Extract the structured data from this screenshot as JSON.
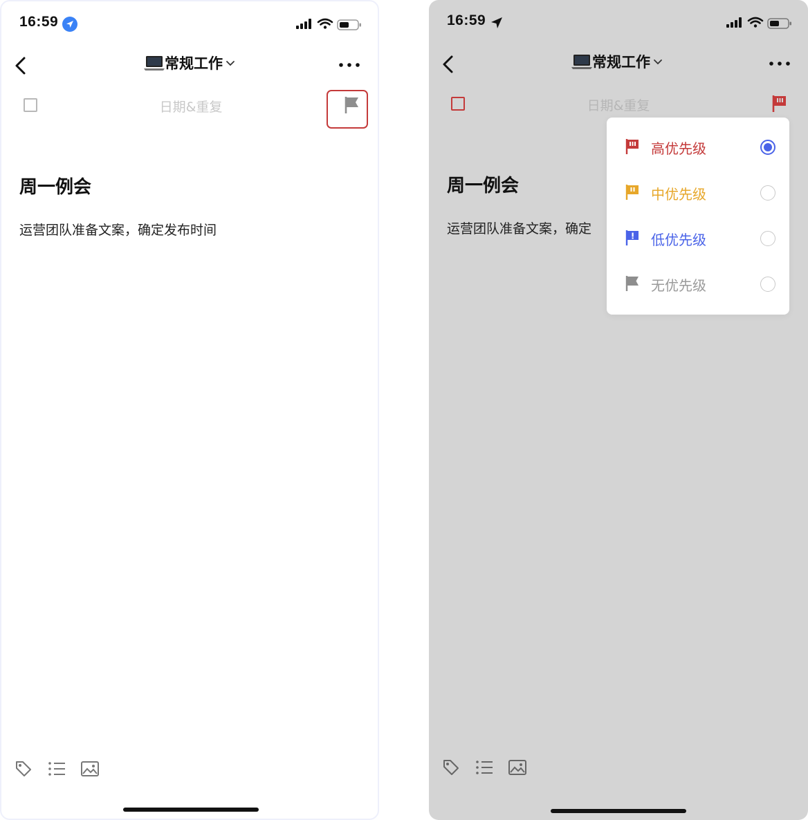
{
  "colors": {
    "high": "#c43a3a",
    "medium": "#e7a72a",
    "low": "#4a63e8",
    "none": "#8e8e8e",
    "overlay_bg": "#d4d4d4",
    "highlight_border": "#c43a3a"
  },
  "left": {
    "status": {
      "time": "16:59"
    },
    "header": {
      "title": "常规工作",
      "emoji_icon": "laptop-icon"
    },
    "task": {
      "date_placeholder": "日期&重复",
      "title": "周一例会",
      "description": "运营团队准备文案，确定发布时间"
    },
    "toolbar": [
      "tag-icon",
      "list-icon",
      "image-icon"
    ]
  },
  "right": {
    "status": {
      "time": "16:59"
    },
    "header": {
      "title": "常规工作",
      "emoji_icon": "laptop-icon"
    },
    "task": {
      "date_placeholder": "日期&重复",
      "title": "周一例会",
      "description": "运营团队准备文案，确定"
    },
    "priority_menu": {
      "options": [
        {
          "label": "高优先级",
          "color": "#c43a3a",
          "selected": true
        },
        {
          "label": "中优先级",
          "color": "#e7a72a",
          "selected": false
        },
        {
          "label": "低优先级",
          "color": "#4a63e8",
          "selected": false
        },
        {
          "label": "无优先级",
          "color": "#8e8e8e",
          "selected": false
        }
      ]
    },
    "toolbar": [
      "tag-icon",
      "list-icon",
      "image-icon"
    ]
  }
}
